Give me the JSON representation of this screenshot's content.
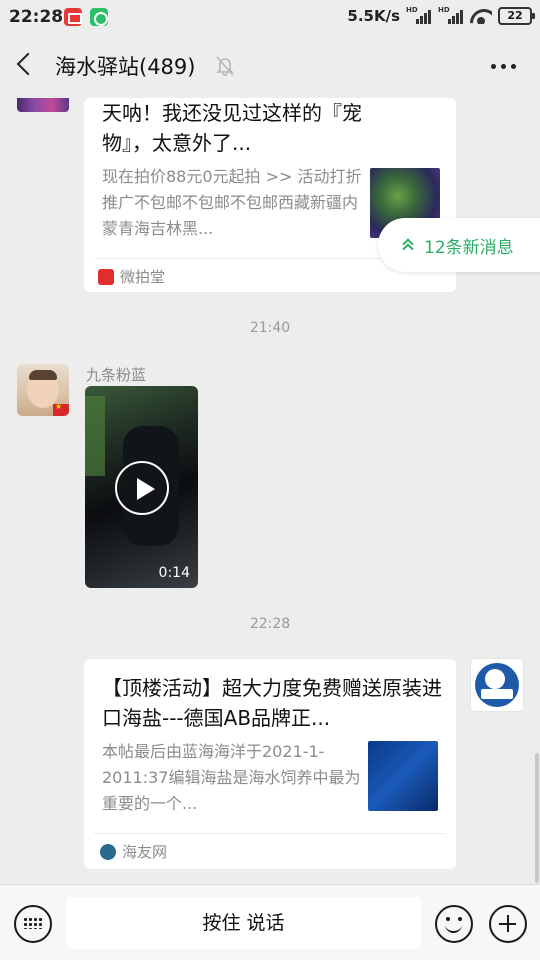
{
  "status_bar": {
    "time": "22:28",
    "net_speed": "5.5K/s",
    "signal_label": "HD",
    "battery": "22"
  },
  "header": {
    "title": "海水驿站(489)"
  },
  "new_messages": "12条新消息",
  "messages": [
    {
      "type": "link_card",
      "title": "天呐！我还没见过这样的『宠物』，太意外了...",
      "description": "现在拍价88元0元起拍 >> 活动打折推广不包邮不包邮不包邮西藏新疆内蒙青海吉林黑...",
      "source": "微拍堂",
      "source_color": "#e02e2e"
    },
    {
      "type": "timestamp",
      "text": "21:40"
    },
    {
      "type": "video",
      "sender": "九条粉蓝",
      "duration": "0:14"
    },
    {
      "type": "timestamp",
      "text": "22:28"
    },
    {
      "type": "link_card",
      "title": "【顶楼活动】超大力度免费赠送原装进口海盐---德国AB品牌正...",
      "description": "本帖最后由蓝海海洋于2021-1-2011:37编辑海盐是海水饲养中最为重要的一个...",
      "source": "海友网",
      "source_color": "#2a6a8a"
    }
  ],
  "input_bar": {
    "hold_to_talk": "按住 说话"
  },
  "colors": {
    "accent_green": "#2aae67",
    "background": "#ededed"
  }
}
